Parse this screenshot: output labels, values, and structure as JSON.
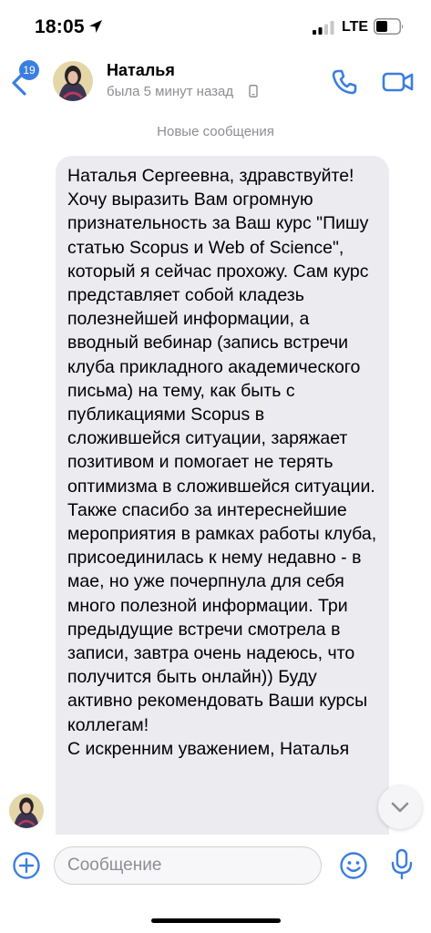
{
  "status_bar": {
    "time": "18:05",
    "network": "LTE"
  },
  "header": {
    "unread_count": "19",
    "contact_name": "Наталья",
    "last_seen": "была 5 минут назад"
  },
  "divider": {
    "label": "Новые сообщения"
  },
  "message": {
    "text": "Наталья Сергеевна, здравствуйте! Хочу выразить Вам огромную признательность за Ваш курс \"Пишу статью Scopus и Web of Science\", который я сейчас прохожу. Сам курс представляет собой кладезь полезнейшей информации, а вводный вебинар (запись встречи клуба прикладного академического письма) на тему, как быть с публикациями Scopus в сложившейся ситуации, заряжает позитивом и помогает не терять оптимизма в сложившейся ситуации.\nТакже спасибо за интереснейшие мероприятия в рамках работы клуба, присоединилась к нему недавно - в мае, но уже почерпнула для себя много полезной информации. Три предыдущие встречи смотрела в записи, завтра очень надеюсь, что получится быть онлайн)) Буду активно рекомендовать Ваши курсы коллегам!\nС искренним уважением, Наталья"
  },
  "composer": {
    "placeholder": "Сообщение"
  },
  "colors": {
    "accent": "#3a7ee0",
    "bubble": "#ebebf0",
    "secondary_text": "#8e8e93"
  },
  "icons": [
    "location-arrow-icon",
    "signal-icon",
    "battery-icon",
    "back-chevron-icon",
    "phone-icon",
    "video-camera-icon",
    "chevron-down-icon",
    "plus-icon",
    "smile-icon",
    "microphone-icon"
  ]
}
